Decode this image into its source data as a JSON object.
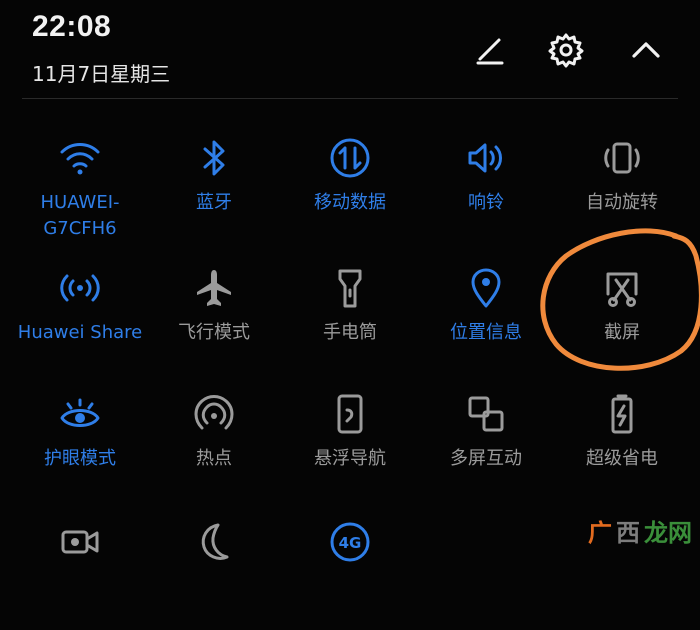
{
  "status": {
    "time": "22:08",
    "date": "11月7日星期三"
  },
  "header": {
    "icons": [
      "edit-icon",
      "settings-icon",
      "collapse-icon"
    ]
  },
  "colors": {
    "active": "#2f7ee8",
    "inactive": "#9b9b9b",
    "annotation": "#f08a3c"
  },
  "tiles": [
    {
      "label": "HUAWEI-\nG7CFH6",
      "icon": "wifi-icon",
      "active": true
    },
    {
      "label": "蓝牙",
      "icon": "bluetooth-icon",
      "active": true
    },
    {
      "label": "移动数据",
      "icon": "mobile-data-icon",
      "active": true
    },
    {
      "label": "响铃",
      "icon": "ring-icon",
      "active": true
    },
    {
      "label": "自动旋转",
      "icon": "auto-rotate-icon",
      "active": false
    },
    {
      "label": "Huawei Share",
      "icon": "huawei-share-icon",
      "active": true
    },
    {
      "label": "飞行模式",
      "icon": "airplane-icon",
      "active": false
    },
    {
      "label": "手电筒",
      "icon": "flashlight-icon",
      "active": false
    },
    {
      "label": "位置信息",
      "icon": "location-icon",
      "active": true
    },
    {
      "label": "截屏",
      "icon": "screenshot-icon",
      "active": false
    },
    {
      "label": "护眼模式",
      "icon": "eye-comfort-icon",
      "active": true
    },
    {
      "label": "热点",
      "icon": "hotspot-icon",
      "active": false
    },
    {
      "label": "悬浮导航",
      "icon": "floating-nav-icon",
      "active": false
    },
    {
      "label": "多屏互动",
      "icon": "multi-screen-icon",
      "active": false
    },
    {
      "label": "超级省电",
      "icon": "power-saving-icon",
      "active": false
    },
    {
      "label": "",
      "icon": "screen-record-icon",
      "active": false
    },
    {
      "label": "",
      "icon": "dark-mode-icon",
      "active": false
    },
    {
      "label": "",
      "icon": "4g-icon",
      "active": true
    }
  ],
  "watermark": {
    "part1": "广",
    "part2": "西",
    "part3": "龙网"
  }
}
